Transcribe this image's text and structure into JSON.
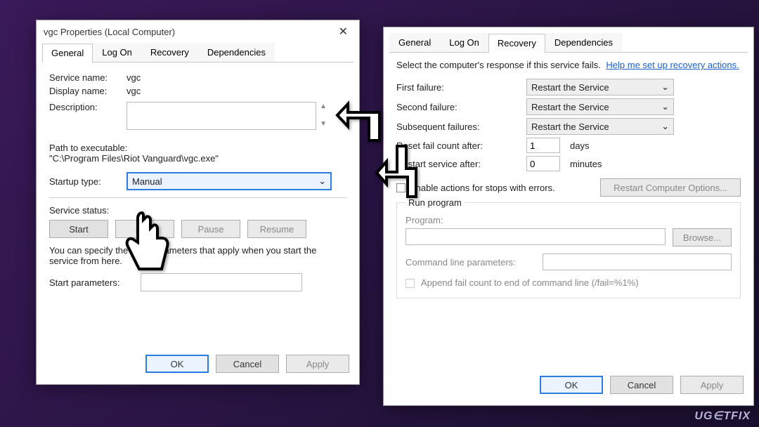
{
  "left": {
    "title": "vgc Properties (Local Computer)",
    "tabs": [
      "General",
      "Log On",
      "Recovery",
      "Dependencies"
    ],
    "activeTab": 0,
    "serviceNameLabel": "Service name:",
    "serviceNameValue": "vgc",
    "displayNameLabel": "Display name:",
    "displayNameValue": "vgc",
    "descriptionLabel": "Description:",
    "pathLabel": "Path to executable:",
    "pathValue": "\"C:\\Program Files\\Riot Vanguard\\vgc.exe\"",
    "startupTypeLabel": "Startup type:",
    "startupTypeValue": "Manual",
    "serviceStatusLabel": "Service status:",
    "btnStart": "Start",
    "btnStop": "Stop",
    "btnPause": "Pause",
    "btnResume": "Resume",
    "helpText": "You can specify the start parameters that apply when you start the service from here.",
    "startParamsLabel": "Start parameters:",
    "ok": "OK",
    "cancel": "Cancel",
    "apply": "Apply"
  },
  "right": {
    "tabs": [
      "General",
      "Log On",
      "Recovery",
      "Dependencies"
    ],
    "activeTab": 2,
    "intro": "Select the computer's response if this service fails.",
    "helpLink": "Help me set up recovery actions.",
    "firstFailLabel": "First failure:",
    "secondFailLabel": "Second failure:",
    "subseqFailLabel": "Subsequent failures:",
    "actionValue": "Restart the Service",
    "resetLabel": "Reset fail count after:",
    "resetValue": "1",
    "resetUnit": "days",
    "restartLabel": "Restart service after:",
    "restartValue": "0",
    "restartUnit": "minutes",
    "enableActionsLabel": "Enable actions for stops with errors.",
    "restartCompBtn": "Restart Computer Options...",
    "runProgTitle": "Run program",
    "programLabel": "Program:",
    "browse": "Browse...",
    "cmdParamsLabel": "Command line parameters:",
    "appendLabel": "Append fail count to end of command line (/fail=%1%)",
    "ok": "OK",
    "cancel": "Cancel",
    "apply": "Apply"
  },
  "watermark": "UG∈TFIX"
}
